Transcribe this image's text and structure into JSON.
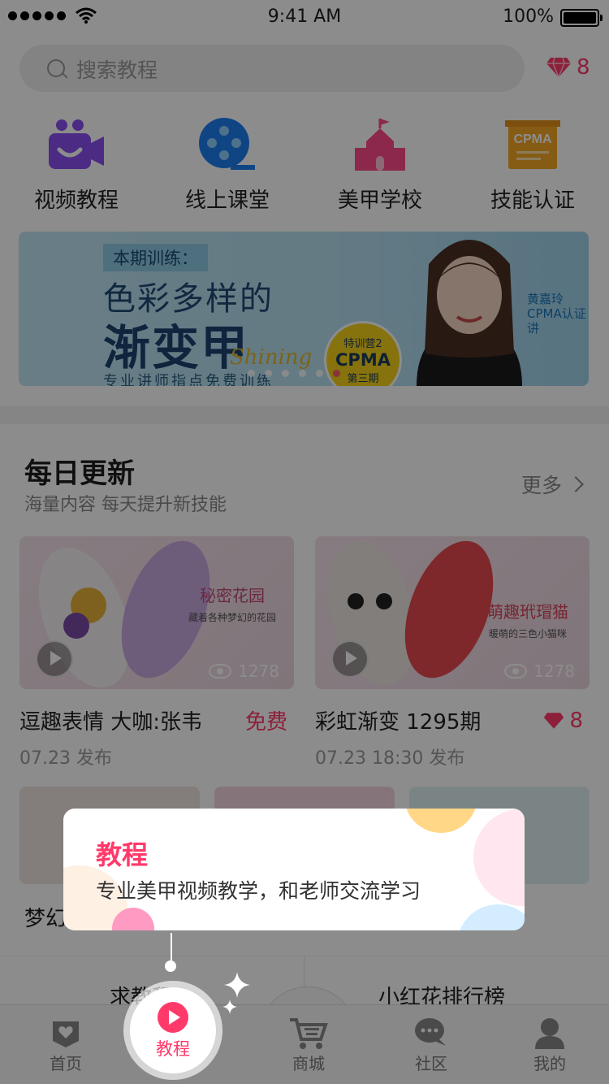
{
  "status_bar": {
    "time": "9:41 AM",
    "battery": "100%"
  },
  "search": {
    "placeholder": "搜索教程"
  },
  "gems": {
    "count": "8"
  },
  "categories": [
    {
      "label": "视频教程"
    },
    {
      "label": "线上课堂"
    },
    {
      "label": "美甲学校"
    },
    {
      "label": "技能认证"
    }
  ],
  "banner": {
    "tag": "本期训练：",
    "line1": "色彩多样的",
    "line2": "渐变甲",
    "line3": "专业讲师指点免费训练",
    "script": "Shining",
    "seal_top": "特训营2",
    "seal_mid": "CPMA",
    "seal_bot": "第三期",
    "teacher_name": "黄嘉玲",
    "teacher_title": "CPMA认证讲",
    "slides": 6,
    "active_slide": 6
  },
  "daily": {
    "title": "每日更新",
    "subtitle": "海量内容 每天提升新技能",
    "more": "更多",
    "cards": [
      {
        "title": "逗趣表情 大咖:张韦",
        "badge": "免费",
        "date": "07.23 发布",
        "views": "1278",
        "thumb_text": "秘密花园",
        "thumb_sub": "藏着各种梦幻的花园"
      },
      {
        "title": "彩虹渐变 1295期",
        "price": "8",
        "date": "07.23 18:30 发布",
        "views": "1278",
        "thumb_text": "萌趣玳瑁猫",
        "thumb_sub": "暖萌的三色小猫咪"
      }
    ],
    "row2_title": "梦幻"
  },
  "links": {
    "left": "求教程",
    "right": "小红花排行榜"
  },
  "tabs": [
    {
      "label": "首页"
    },
    {
      "label": "教程"
    },
    {
      "label": "商城"
    },
    {
      "label": "社区"
    },
    {
      "label": "我的"
    }
  ],
  "tooltip": {
    "title": "教程",
    "text": "专业美甲视频教学，和老师交流学习"
  },
  "colors": {
    "accent": "#ff3a6b",
    "overlay": "rgba(0,0,0,0.45)"
  }
}
